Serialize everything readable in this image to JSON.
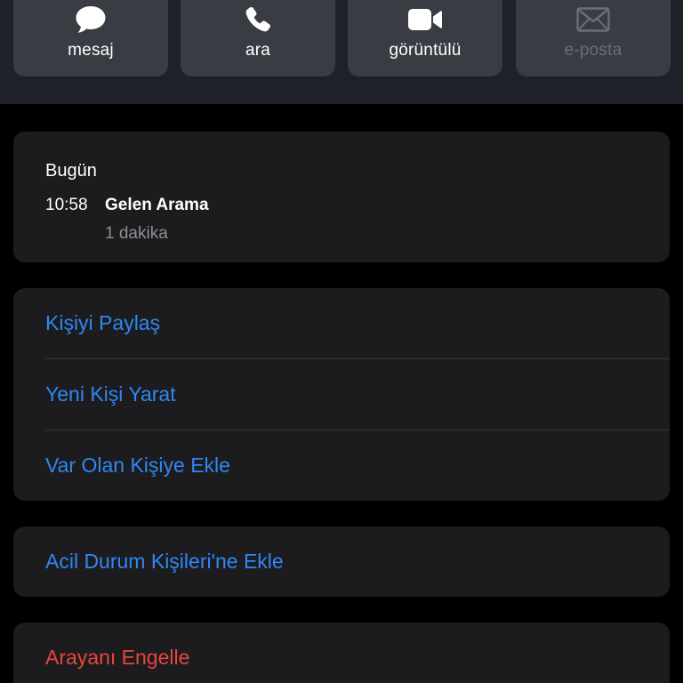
{
  "actions": [
    {
      "label": "mesaj",
      "icon": "message-bubble-icon",
      "enabled": true
    },
    {
      "label": "ara",
      "icon": "phone-icon",
      "enabled": true
    },
    {
      "label": "görüntülü",
      "icon": "video-camera-icon",
      "enabled": true
    },
    {
      "label": "e-posta",
      "icon": "envelope-icon",
      "enabled": false
    }
  ],
  "recents": {
    "day": "Bugün",
    "time": "10:58",
    "type": "Gelen Arama",
    "duration": "1 dakika"
  },
  "options": {
    "share_contact": "Kişiyi Paylaş",
    "create_new_contact": "Yeni Kişi Yarat",
    "add_to_existing": "Var Olan Kişiye Ekle"
  },
  "emergency": {
    "add_label": "Acil Durum Kişileri'ne Ekle"
  },
  "block": {
    "label": "Arayanı Engelle"
  },
  "colors": {
    "accent": "#2f87f3",
    "danger": "#eb4440",
    "card": "#1c1c1e",
    "header": "#1f2128",
    "button": "#3a3c44",
    "secondary_text": "#8e8e93",
    "disabled_text": "#6c6e75"
  }
}
